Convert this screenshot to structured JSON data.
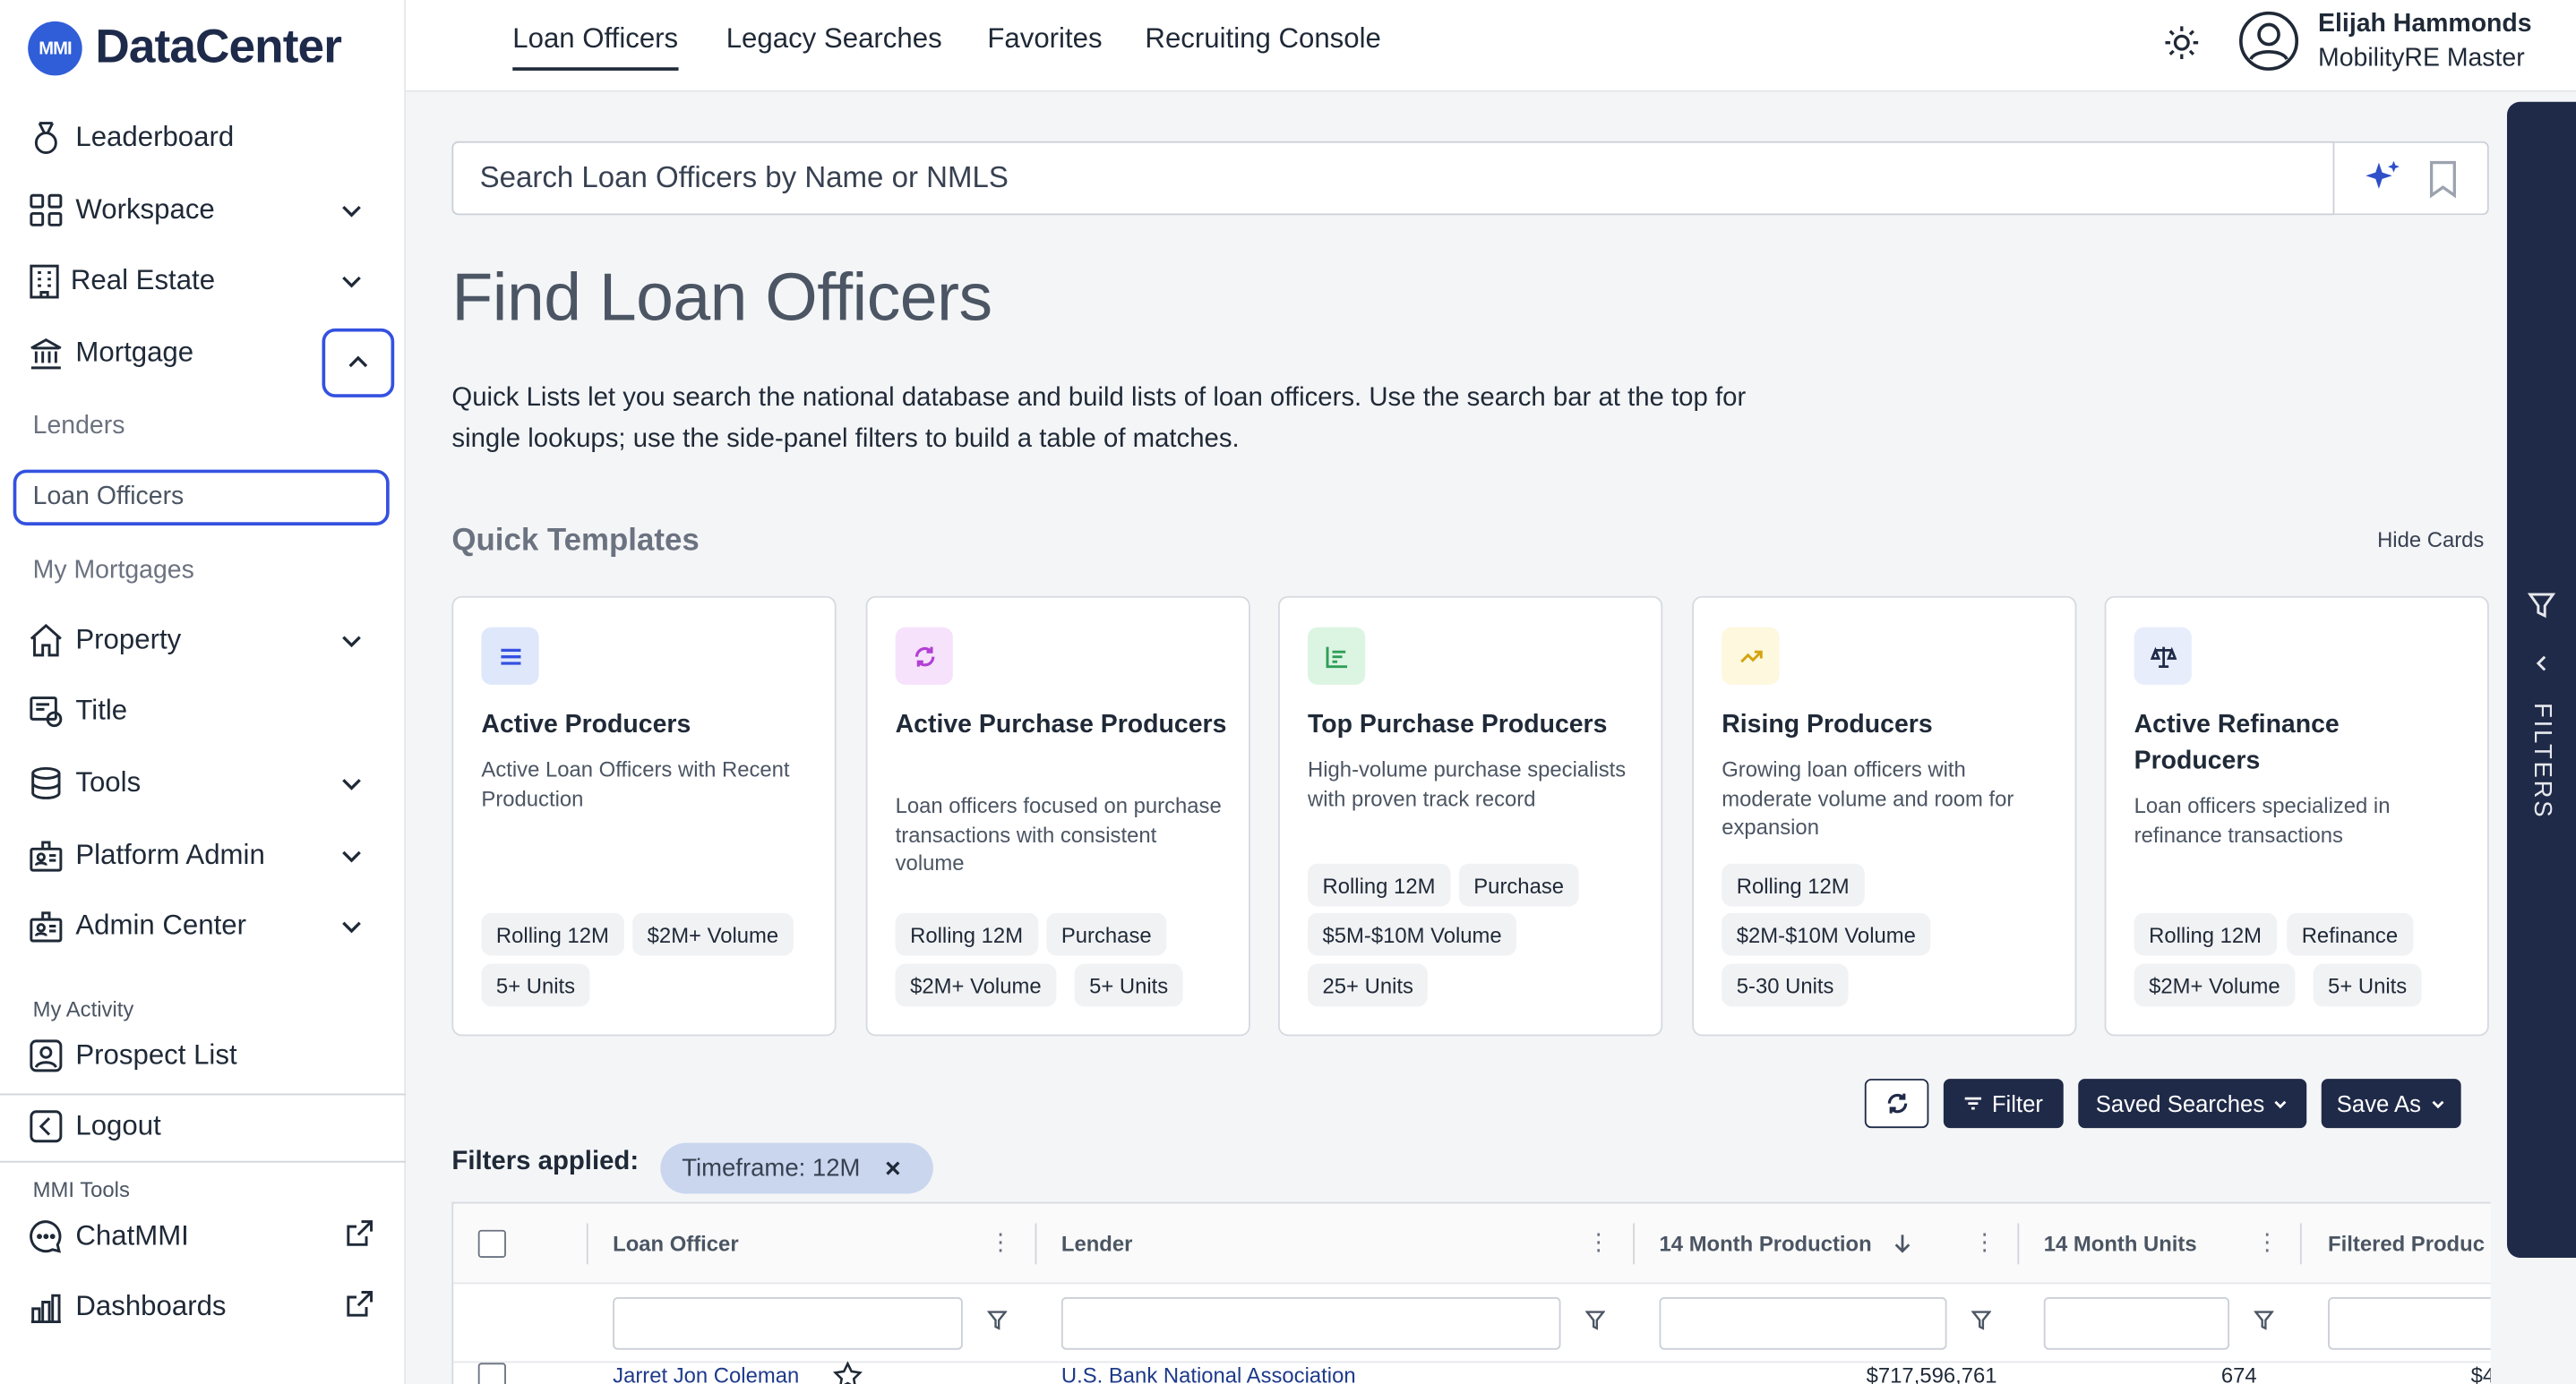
{
  "app": {
    "logo_mark": "MMI",
    "name": "DataCenter"
  },
  "sidebar": {
    "items": [
      {
        "label": "Leaderboard",
        "icon": "medal-icon"
      },
      {
        "label": "Workspace",
        "icon": "grid-icon"
      },
      {
        "label": "Real Estate",
        "icon": "building-icon"
      },
      {
        "label": "Mortgage",
        "icon": "bank-icon"
      },
      {
        "label": "Property",
        "icon": "home-icon"
      },
      {
        "label": "Title",
        "icon": "certificate-icon"
      },
      {
        "label": "Tools",
        "icon": "database-icon"
      },
      {
        "label": "Platform Admin",
        "icon": "admin-icon"
      },
      {
        "label": "Admin Center",
        "icon": "admin-icon"
      }
    ],
    "mortgage_sub": [
      "Lenders",
      "Loan Officers",
      "My Mortgages"
    ],
    "my_activity_label": "My Activity",
    "prospect_list": "Prospect List",
    "logout": "Logout",
    "mmi_tools_label": "MMI Tools",
    "chatmmi": "ChatMMI",
    "dashboards": "Dashboards"
  },
  "topnav": {
    "tabs": [
      "Loan Officers",
      "Legacy Searches",
      "Favorites",
      "Recruiting Console"
    ],
    "active_tab": "Loan Officers",
    "user_name": "Elijah Hammonds",
    "user_role": "MobilityRE Master"
  },
  "search": {
    "placeholder": "Search Loan Officers by Name or NMLS"
  },
  "main": {
    "title": "Find Loan Officers",
    "intro": "Quick Lists let you search the national database and build lists of loan officers. Use the search bar at the top for single lookups; use the side-panel filters to build a table of matches.",
    "templates_title": "Quick Templates",
    "hide_cards": "Hide Cards"
  },
  "cards": [
    {
      "title": "Active Producers",
      "desc": "Active Loan Officers with Recent Production",
      "chips": [
        "Rolling 12M",
        "$2M+ Volume",
        "5+ Units"
      ],
      "icon": "list-icon",
      "icon_bg": "#dfe7fb",
      "icon_color": "#3451e0"
    },
    {
      "title": "Active Purchase Producers",
      "desc": "Loan officers focused on purchase transactions with consistent volume",
      "chips": [
        "Rolling 12M",
        "Purchase",
        "$2M+ Volume",
        "5+ Units"
      ],
      "icon": "cycle-icon",
      "icon_bg": "#f6e3fb",
      "icon_color": "#b23fd6"
    },
    {
      "title": "Top Purchase Producers",
      "desc": "High-volume purchase specialists with proven track record",
      "chips": [
        "Rolling 12M",
        "Purchase",
        "$5M-$10M Volume",
        "25+ Units"
      ],
      "icon": "bar-chart-icon",
      "icon_bg": "#dcf5e3",
      "icon_color": "#2f9e57"
    },
    {
      "title": "Rising Producers",
      "desc": "Growing loan officers with moderate volume and room for expansion",
      "chips": [
        "Rolling 12M",
        "$2M-$10M Volume",
        "5-30 Units"
      ],
      "icon": "trend-up-icon",
      "icon_bg": "#fdf8de",
      "icon_color": "#d4a30e"
    },
    {
      "title": "Active Refinance Producers",
      "desc": "Loan officers specialized in refinance transactions",
      "chips": [
        "Rolling 12M",
        "Refinance",
        "$2M+ Volume",
        "5+ Units"
      ],
      "icon": "scale-icon",
      "icon_bg": "#e7edfb",
      "icon_color": "#1f2a48"
    }
  ],
  "toolbar": {
    "filter": "Filter",
    "saved_searches": "Saved Searches",
    "save_as": "Save As"
  },
  "filters_applied": {
    "label": "Filters applied:",
    "pill": "Timeframe: 12M"
  },
  "table": {
    "columns": [
      "Loan Officer",
      "Lender",
      "14 Month Production",
      "14 Month Units",
      "Filtered Produc"
    ],
    "rows": [
      {
        "officer": "Jarret Jon Coleman",
        "lender": "U.S. Bank National Association",
        "production": "$717,596,761",
        "units": "674",
        "filtered": "$4"
      }
    ]
  },
  "filters_rail": {
    "label": "FILTERS"
  }
}
